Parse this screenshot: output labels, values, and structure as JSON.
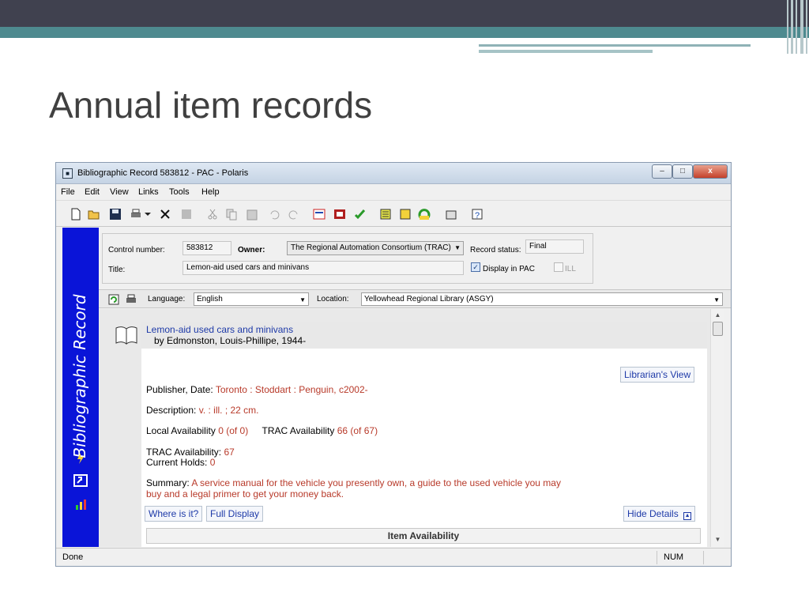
{
  "slide": {
    "title": "Annual item records"
  },
  "window": {
    "title": "Bibliographic Record 583812 - PAC -  Polaris",
    "controls": {
      "minimize": "–",
      "maximize": "□",
      "close": "x"
    }
  },
  "menu": [
    "File",
    "Edit",
    "View",
    "Links",
    "Tools",
    "Help"
  ],
  "banner": {
    "text": "Bibliographic Record"
  },
  "fields": {
    "control_number_label": "Control number:",
    "control_number": "583812",
    "owner_label": "Owner:",
    "owner": "The Regional Automation Consortium (TRAC)",
    "record_status_label": "Record status:",
    "record_status": "Final",
    "title_label": "Title:",
    "title": "Lemon-aid used cars and minivans",
    "display_in_pac_label": "Display in PAC",
    "display_in_pac_checked": "✓",
    "ill_label": "ILL"
  },
  "langbar": {
    "language_label": "Language:",
    "language": "English",
    "location_label": "Location:",
    "location": "Yellowhead Regional Library (ASGY)"
  },
  "record": {
    "title": "Lemon-aid used cars and minivans",
    "author": "by Edmonston, Louis-Phillipe, 1944-",
    "librarian_view": "Librarian's View",
    "publisher_label": "Publisher, Date:",
    "publisher": "Toronto : Stoddart : Penguin, c2002-",
    "description_label": "Description:",
    "description": "v. : ill. ; 22 cm.",
    "local_avail_label": "Local Availability",
    "local_avail": "0 (of 0)",
    "trac_avail_label": "TRAC Availability",
    "trac_avail": "66 (of 67)",
    "trac_avail2_label": "TRAC Availability:",
    "trac_avail2": "67",
    "holds_label": "Current Holds:",
    "holds": "0",
    "summary_label": "Summary:",
    "summary_line1": "A service manual for the vehicle you presently own, a guide to the used vehicle you may",
    "summary_line2": "buy and a legal primer to get your money back.",
    "where_is_it": "Where is it?",
    "full_display": "Full Display",
    "hide_details": "Hide Details",
    "item_availability": "Item Availability"
  },
  "status": {
    "text": "Done",
    "num": "NUM"
  },
  "colors": {
    "banner": "#0a14d8",
    "link": "#1e3aa8",
    "value": "#b83a2a",
    "slide_teal": "#4e8a8f"
  }
}
